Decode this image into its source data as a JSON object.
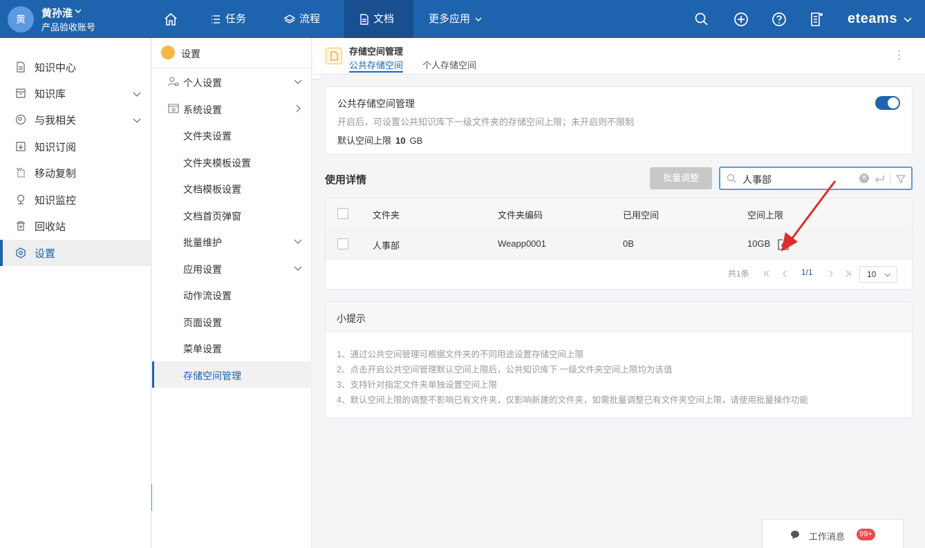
{
  "header": {
    "avatar_text": "黄",
    "user_name": "黄孙淮",
    "account": "产品验收账号",
    "nav": [
      {
        "label": ""
      },
      {
        "label": "任务"
      },
      {
        "label": "流程"
      },
      {
        "label": "文档"
      },
      {
        "label": "更多应用"
      }
    ],
    "brand": "eteams",
    "accent": "#1e63ad"
  },
  "leftnav": {
    "items": [
      {
        "label": "知识中心",
        "icon": "document-icon"
      },
      {
        "label": "知识库",
        "icon": "box-icon"
      },
      {
        "label": "与我相关",
        "icon": "person-icon"
      },
      {
        "label": "知识订阅",
        "icon": "subscribe-icon"
      },
      {
        "label": "移动复制",
        "icon": "copy-icon"
      },
      {
        "label": "知识监控",
        "icon": "monitor-icon"
      },
      {
        "label": "回收站",
        "icon": "trash-icon"
      },
      {
        "label": "设置",
        "icon": "settings-icon"
      }
    ]
  },
  "subnav": {
    "title": "设置",
    "items": [
      {
        "label": "个人设置"
      },
      {
        "label": "系统设置"
      },
      {
        "label": "文件夹设置"
      },
      {
        "label": "文件夹模板设置"
      },
      {
        "label": "文档模板设置"
      },
      {
        "label": "文档首页弹窗"
      },
      {
        "label": "批量维护"
      },
      {
        "label": "应用设置"
      },
      {
        "label": "动作流设置"
      },
      {
        "label": "页面设置"
      },
      {
        "label": "菜单设置"
      },
      {
        "label": "存储空间管理"
      }
    ]
  },
  "main": {
    "title": "存储空间管理",
    "tabs": [
      "公共存储空间",
      "个人存储空间"
    ],
    "public_card": {
      "title": "公共存储空间管理",
      "desc": "开启后，可设置公共知识库下一级文件夹的存储空间上限；未开启则不限制",
      "limit_label": "默认空间上限",
      "limit_value": "10",
      "limit_unit": "GB",
      "toggle_on": true
    },
    "usage_title": "使用详情",
    "batch_button": "批量调整",
    "search_value": "人事部",
    "table": {
      "columns": [
        "文件夹",
        "文件夹编码",
        "已用空间",
        "空间上限"
      ],
      "rows": [
        {
          "folder": "人事部",
          "code": "Weapp0001",
          "used": "0B",
          "limit": "10GB"
        }
      ]
    },
    "pagination": {
      "total": "共1条",
      "page": "1/1",
      "size": "10"
    },
    "tips": {
      "title": "小提示",
      "items": [
        "1、通过公共空间管理可根据文件夹的不同用途设置存储空间上限",
        "2、点击开启公共空间管理默认空间上限后，公共知识库下 一级文件夹空间上限均为该值",
        "3、支持针对指定文件夹单独设置空间上限",
        "4、默认空间上限的调整不影响已有文件夹，仅影响新建的文件夹，如需批量调整已有文件夹空间上限，请使用批量操作功能"
      ]
    }
  },
  "messages": {
    "label": "工作消息",
    "count": "99+"
  }
}
